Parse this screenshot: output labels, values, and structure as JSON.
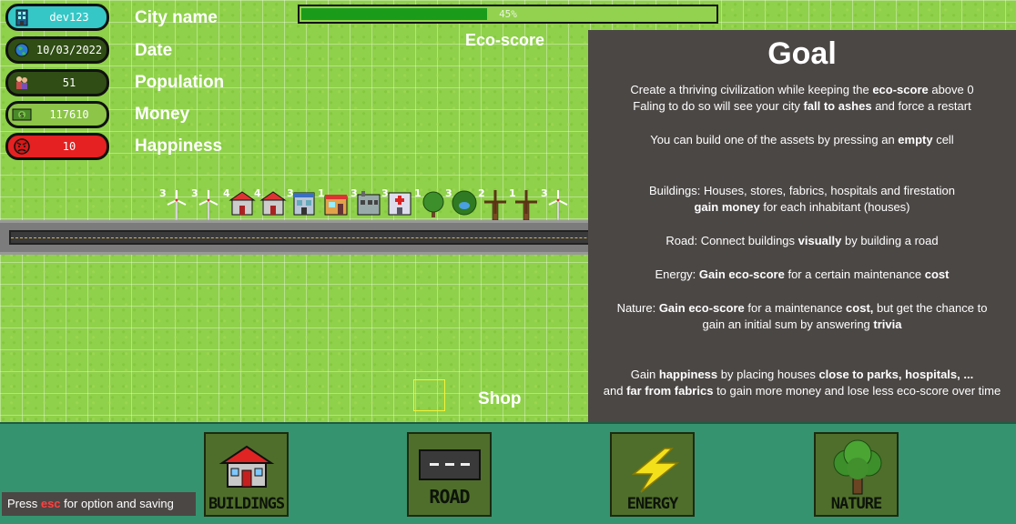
{
  "hud": {
    "city_name": {
      "value": "dev123",
      "label": "City name",
      "icon": "building-icon",
      "color": "#35c7c6"
    },
    "date": {
      "value": "10/03/2022",
      "label": "Date",
      "icon": "globe-icon",
      "color": "#2f4d14"
    },
    "population": {
      "value": "51",
      "label": "Population",
      "icon": "people-icon",
      "color": "#2f4d14"
    },
    "money": {
      "value": "117610",
      "label": "Money",
      "icon": "banknote-icon",
      "color": "#8cc548"
    },
    "happiness": {
      "value": "10",
      "label": "Happiness",
      "icon": "angry-face-icon",
      "color": "#e52121"
    }
  },
  "eco": {
    "label": "Eco-score",
    "percent_text": "45%",
    "fraction": 0.45
  },
  "assets": [
    {
      "count": "3",
      "icon": "wind-turbine-icon"
    },
    {
      "count": "3",
      "icon": "wind-turbine-icon"
    },
    {
      "count": "4",
      "icon": "house-icon"
    },
    {
      "count": "4",
      "icon": "house-icon"
    },
    {
      "count": "3",
      "icon": "store-icon"
    },
    {
      "count": "1",
      "icon": "shop-icon"
    },
    {
      "count": "3",
      "icon": "fabric-icon"
    },
    {
      "count": "3",
      "icon": "hospital-icon"
    },
    {
      "count": "1",
      "icon": "tree-icon"
    },
    {
      "count": "3",
      "icon": "park-icon"
    },
    {
      "count": "2",
      "icon": "windmill-icon"
    },
    {
      "count": "1",
      "icon": "windmill-icon"
    },
    {
      "count": "3",
      "icon": "wind-turbine-icon"
    }
  ],
  "shop_label": "Shop",
  "goal": {
    "title": "Goal",
    "p1_a": "Create a thriving civilization while keeping the ",
    "p1_b": "eco-score",
    "p1_c": " above 0",
    "p1_d": "Faling to do so will see your city ",
    "p1_e": "fall to ashes",
    "p1_f": " and force a restart",
    "p2_a": "You can build one of the assets by pressing an ",
    "p2_b": "empty",
    "p2_c": " cell",
    "p3_a": "Buildings: Houses, stores, fabrics, hospitals and firestation",
    "p3_b": "gain money",
    "p3_c": " for each inhabitant (houses)",
    "p4_a": "Road: Connect buildings ",
    "p4_b": "visually",
    "p4_c": " by building a road",
    "p5_a": "Energy: ",
    "p5_b": "Gain eco-score",
    "p5_c": " for a certain maintenance ",
    "p5_d": "cost",
    "p6_a": "Nature: ",
    "p6_b": "Gain eco-score",
    "p6_c": " for a maintenance ",
    "p6_d": "cost,",
    "p6_e": " but get the chance to",
    "p6_f": "gain an initial sum by answering ",
    "p6_g": "trivia",
    "p7_a": "Gain ",
    "p7_b": "happiness",
    "p7_c": " by placing houses ",
    "p7_d": "close to parks, hospitals, ...",
    "p7_e": "and ",
    "p7_f": "far from fabrics",
    "p7_g": " to gain more money and lose less eco-score over time"
  },
  "categories": {
    "buildings": "BUILDINGS",
    "road": "ROAD",
    "energy": "ENERGY",
    "nature": "NATURE"
  },
  "esc_hint": {
    "pre": "Press ",
    "key": "esc",
    "post": " for option and saving"
  }
}
